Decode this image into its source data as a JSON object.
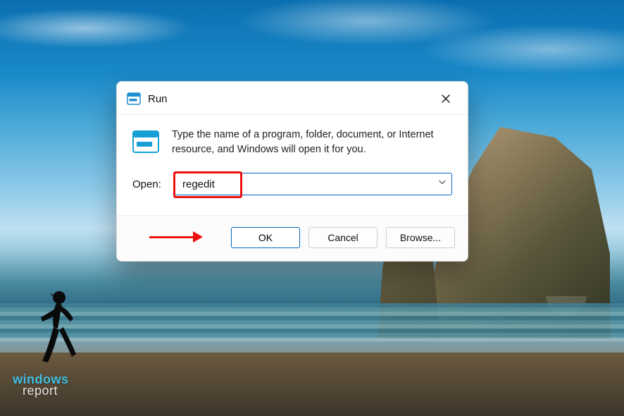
{
  "dialog": {
    "title": "Run",
    "description": "Type the name of a program, folder, document, or Internet resource, and Windows will open it for you.",
    "open_label": "Open:",
    "input_value": "regedit",
    "buttons": {
      "ok": "OK",
      "cancel": "Cancel",
      "browse": "Browse..."
    }
  },
  "watermark": {
    "line1": "windows",
    "line2": "report"
  },
  "colors": {
    "accent": "#0067c0",
    "annotation": "#e11"
  }
}
